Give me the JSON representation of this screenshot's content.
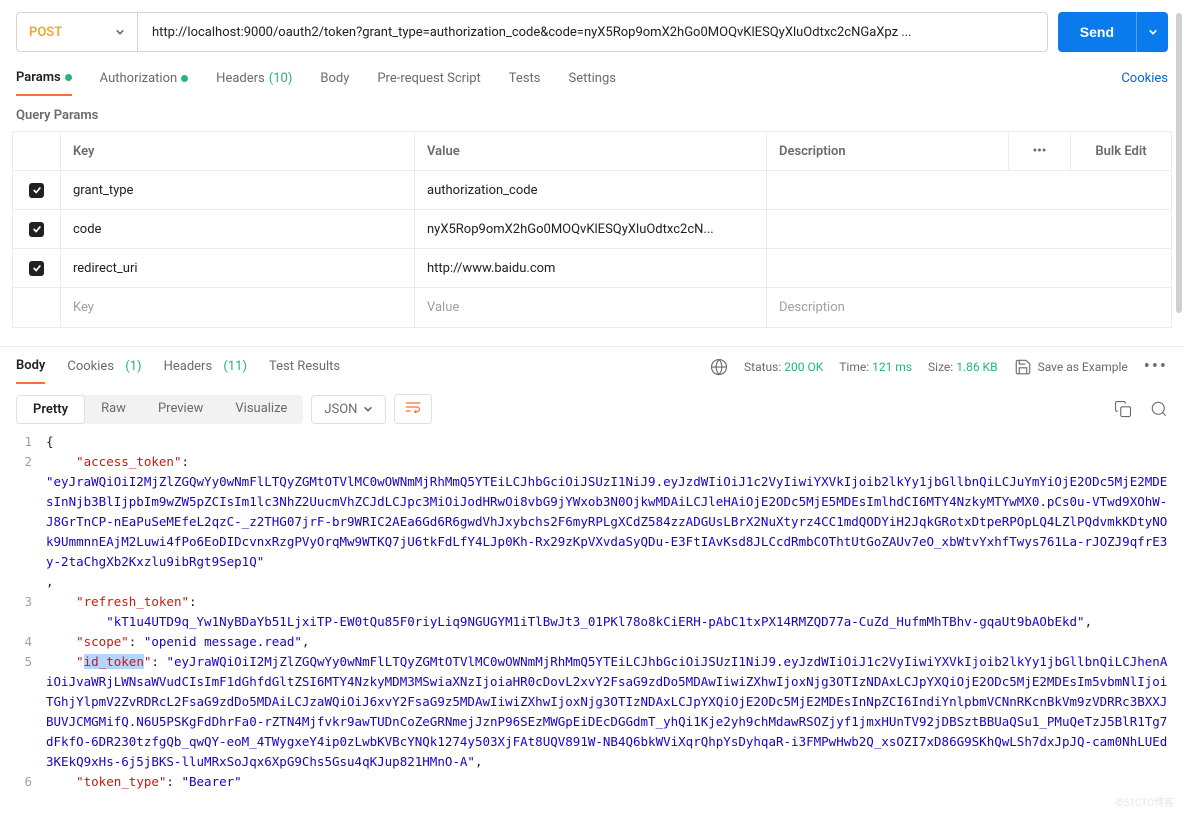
{
  "request": {
    "method": "POST",
    "url": "http://localhost:9000/oauth2/token?grant_type=authorization_code&code=nyX5Rop9omX2hGo0MOQvKlESQyXluOdtxc2cNGaXpz ...",
    "send_label": "Send"
  },
  "req_tabs": {
    "params": "Params",
    "auth": "Authorization",
    "headers": "Headers",
    "headers_count": "(10)",
    "body": "Body",
    "prereq": "Pre-request Script",
    "tests": "Tests",
    "settings": "Settings",
    "cookies": "Cookies"
  },
  "query_params": {
    "title": "Query Params",
    "hdr_key": "Key",
    "hdr_value": "Value",
    "hdr_desc": "Description",
    "bulk": "Bulk Edit",
    "rows": [
      {
        "key": "grant_type",
        "value": "authorization_code",
        "desc": ""
      },
      {
        "key": "code",
        "value": "nyX5Rop9omX2hGo0MOQvKlESQyXluOdtxc2cN...",
        "desc": ""
      },
      {
        "key": "redirect_uri",
        "value": "http://www.baidu.com",
        "desc": ""
      }
    ],
    "ph_key": "Key",
    "ph_value": "Value",
    "ph_desc": "Description"
  },
  "resp_tabs": {
    "body": "Body",
    "cookies": "Cookies",
    "cookies_count": "(1)",
    "headers": "Headers",
    "headers_count": "(11)",
    "tests": "Test Results"
  },
  "resp_status": {
    "status_lbl": "Status:",
    "status_val": "200 OK",
    "time_lbl": "Time:",
    "time_val": "121 ms",
    "size_lbl": "Size:",
    "size_val": "1.86 KB",
    "save_example": "Save as Example"
  },
  "viewer": {
    "pretty": "Pretty",
    "raw": "Raw",
    "preview": "Preview",
    "visualize": "Visualize",
    "lang": "JSON"
  },
  "json_body": {
    "l1": "{",
    "k2": "\"access_token\"",
    "v2": "\"eyJraWQiOiI2MjZlZGQwYy0wNmFlLTQyZGMtOTVlMC0wOWNmMjRhMmQ5YTEiLCJhbGciOiJSUzI1NiJ9.eyJzdWIiOiJ1c2VyIiwiYXVkIjoib2lkYy1jbGllbnQiLCJuYmYiOjE2ODc5MjE2MDEsInNjb3BlIjpbIm9wZW5pZCIsIm1lc3NhZ2UucmVhZCJdLCJpc3MiOiJodHRwOi8vbG9jYWxob3N0OjkwMDAiLCJleHAiOjE2ODc5MjE5MDEsImlhdCI6MTY4NzkyMTYwMX0.pCs0u-VTwd9XOhW-J8GrTnCP-nEaPuSeMEfeL2qzC-_z2THG07jrF-br9WRIC2AEa6Gd6R6gwdVhJxybchs2F6myRPLgXCdZ584zzADGUsLBrX2NuXtyrz4CC1mdQODYiH2JqkGRotxDtpeRPOpLQ4LZlPQdvmkKDtyNOk9UmmnnEAjM2Luwi4fPo6EoDIDcvnxRzgPVyOrqMw9WTKQ7jU6tkFdLfY4LJp0Kh-Rx29zKpVXvdaSyQDu-E3FtIAvKsd8JLCcdRmbCOThtUtGoZAUv7eO_xbWtvYxhfTwys761La-rJOZJ9qfrE3y-2taChgXb2Kxzlu9ibRgt9Sep1Q\"",
    "k3": "\"refresh_token\"",
    "v3": "\"kT1u4UTD9q_Yw1NyBDaYb51LjxiTP-EW0tQu85F0riyLiq9NGUGYM1iTlBwJt3_01PKl78o8kCiERH-pAbC1txPX14RMZQD77a-CuZd_HufmMhTBhv-gqaUt9bAObEkd\"",
    "k4": "\"scope\"",
    "v4": "\"openid message.read\"",
    "k5a": "\"",
    "k5b": "id_token",
    "k5c": "\"",
    "v5": "\"eyJraWQiOiI2MjZlZGQwYy0wNmFlLTQyZGMtOTVlMC0wOWNmMjRhMmQ5YTEiLCJhbGciOiJSUzI1NiJ9.eyJzdWIiOiJ1c2VyIiwiYXVkIjoib2lkYy1jbGllbnQiLCJhenAiOiJvaWRjLWNsaWVudCIsImF1dGhfdGltZSI6MTY4NzkyMDM3MSwiaXNzIjoiaHR0cDovL2xvY2FsaG9zdDo5MDAwIiwiZXhwIjoxNjg3OTIzNDAxLCJpYXQiOjE2ODc5MjE2MDEsIm5vbmNlIjoiTGhjYlpmV2ZvRDRcL2FsaG9zdDo5MDAiLCJzaWQiOiJ6xvY2FsaG9z5MDAwIiwiZXhwIjoxNjg3OTIzNDAxLCJpYXQiOjE2ODc5MjE2MDEsInNpZCI6IndiYnlpbmVCNnRKcnBkVm9zVDRRc3BXXJBUVJCMGMifQ.N6U5PSKgFdDhrFa0-rZTN4Mjfvkr9awTUDnCoZeGRNmejJznP96SEzMWGpEiDEcDGGdmT_yhQi1Kje2yh9chMdawRSOZjyf1jmxHUnTV92jDBSztBBUaQSu1_PMuQeTzJ5BlR1Tg7dFkfO-6DR230tzfgQb_qwQY-eoM_4TWygxeY4ip0zLwbKVBcYNQk1274y503XjFAt8UQV891W-NB4Q6bkWViXqrQhpYsDyhqaR-i3FMPwHwb2Q_xsOZI7xD86G9SKhQwLSh7dxJpJQ-cam0NhLUEd3KEkQ9xHs-6j5jBKS-lluMRxSoJqx6XpG9Chs5Gsu4qKJup821HMnO-A\"",
    "k6": "\"token_type\"",
    "v6": "\"Bearer\""
  },
  "watermark": "©51CTO博客"
}
